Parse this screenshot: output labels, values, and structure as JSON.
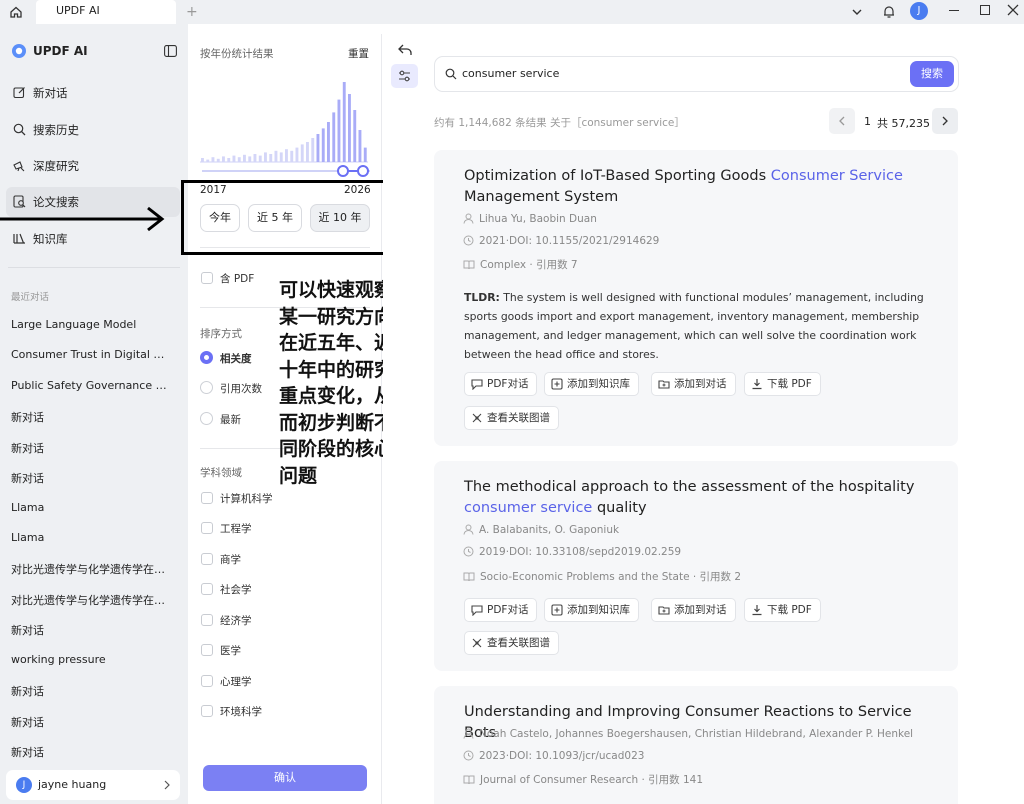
{
  "titlebar": {
    "tab_title": "UPDF AI",
    "avatar_initial": "J"
  },
  "sidebar": {
    "brand": "UPDF AI",
    "nav": [
      {
        "label": "新对话",
        "icon": "edit-icon"
      },
      {
        "label": "搜索历史",
        "icon": "search-icon"
      },
      {
        "label": "深度研究",
        "icon": "research-icon"
      },
      {
        "label": "论文搜索",
        "icon": "paper-search-icon",
        "active": true
      },
      {
        "label": "知识库",
        "icon": "library-icon"
      }
    ],
    "recent_heading": "最近对话",
    "recent": [
      "Large Language Model",
      "Consumer Trust in Digital Ma...",
      "Public Safety Governance an...",
      "新对话",
      "新对话",
      "新对话",
      "Llama",
      "Llama",
      "对比光遗传学与化学遗传学在啮...",
      "对比光遗传学与化学遗传学在啮...",
      "新对话",
      "working pressure",
      "新对话",
      "新对话",
      "新对话"
    ],
    "user_name": "jayne huang",
    "user_initial": "J"
  },
  "filter": {
    "year_title": "按年份统计结果",
    "reset": "重置",
    "year_start": "2017",
    "year_end": "2026",
    "quick": [
      "今年",
      "近 5 年",
      "近 10 年"
    ],
    "pdf_only": "含 PDF",
    "sort_title": "排序方式",
    "sort_options": [
      "相关度",
      "引用次数",
      "最新"
    ],
    "subject_title": "学科领域",
    "subjects": [
      "计算机科学",
      "工程学",
      "商学",
      "社会学",
      "经济学",
      "医学",
      "心理学",
      "环境科学"
    ],
    "confirm": "确认"
  },
  "annotation": {
    "text_lines": [
      "可以快速观察",
      "某一研究方向",
      "在近五年、近",
      "十年中的研究",
      "重点变化，从",
      "而初步判断不",
      "同阶段的核心",
      "问题"
    ]
  },
  "search": {
    "query": "consumer service",
    "button": "搜索"
  },
  "results": {
    "summary": "约有 1,144,682 条结果 关于［consumer service］",
    "page": "1",
    "total_pages": "共 57,235"
  },
  "papers": [
    {
      "title_pre": "Optimization of IoT-Based Sporting Goods ",
      "title_hl": "Consumer Service",
      "title_post": " Management System",
      "authors": "Lihua Yu,  Baobin Duan",
      "year_doi": "2021·DOI: 10.1155/2021/2914629",
      "venue": "Complex · 引用数 7",
      "tldr_label": "TLDR:",
      "tldr": " The system is well designed with functional modules’   management, including sports goods import and export management, inventory management, membership management, and ledger management, which can well solve the coordination work between the head office and stores."
    },
    {
      "title_pre": "The methodical approach to the assessment of the hospitality ",
      "title_hl": "consumer service",
      "title_post": " quality",
      "authors": "A. Balabanits,  O. Gaponiuk",
      "year_doi": "2019·DOI: 10.33108/sepd2019.02.259",
      "venue": "Socio-Economic Problems and the State · 引用数 2"
    },
    {
      "title_pre": "Understanding and Improving Consumer Reactions to Service Bots",
      "title_hl": "",
      "title_post": "",
      "authors": "Noah Castelo,  Johannes Boegershausen,  Christian Hildebrand,  Alexander P. Henkel",
      "year_doi": "2023·DOI: 10.1093/jcr/ucad023",
      "venue": "Journal of Consumer Research · 引用数 141"
    }
  ],
  "actions": {
    "pdf_chat": "PDF对话",
    "add_kb": "添加到知识库",
    "add_chat": "添加到对话",
    "download": "下载 PDF",
    "graph": "查看关联图谱"
  },
  "chart_data": {
    "type": "bar",
    "description": "publication count histogram by year (relative heights)",
    "values": [
      0.05,
      0.03,
      0.06,
      0.04,
      0.07,
      0.05,
      0.08,
      0.06,
      0.09,
      0.07,
      0.1,
      0.08,
      0.12,
      0.1,
      0.14,
      0.12,
      0.16,
      0.14,
      0.18,
      0.22,
      0.25,
      0.3,
      0.35,
      0.42,
      0.5,
      0.62,
      0.78,
      1.0,
      0.85,
      0.65,
      0.4,
      0.18
    ]
  },
  "colors": {
    "accent": "#6b70f5",
    "accent_light": "#e9eafe",
    "sidebar_bg": "#eef0f3",
    "annotation_border": "#000000"
  }
}
